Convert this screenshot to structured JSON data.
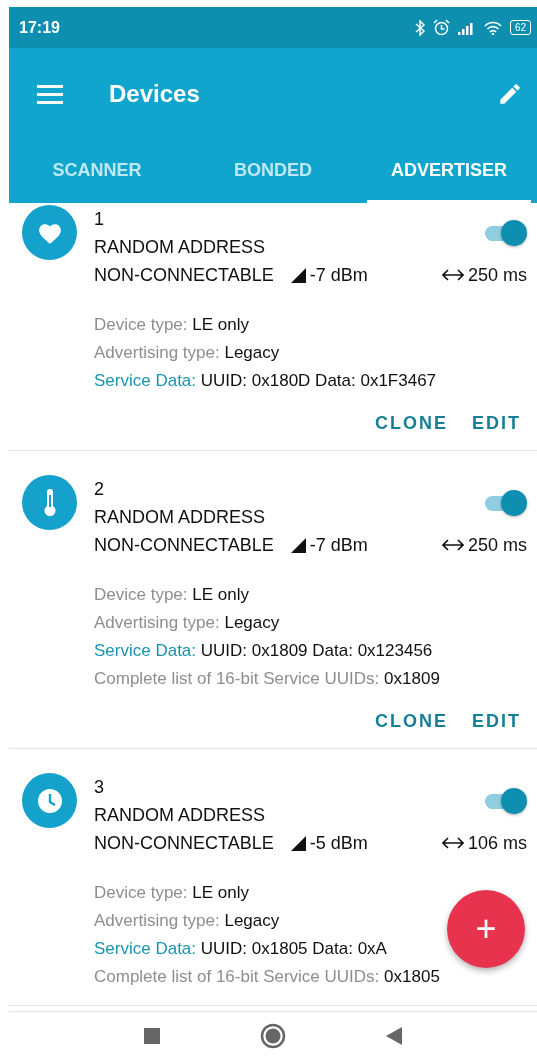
{
  "status_bar": {
    "time": "17:19",
    "battery": "62"
  },
  "toolbar": {
    "title": "Devices"
  },
  "tabs": [
    {
      "label": "SCANNER",
      "selected": false
    },
    {
      "label": "BONDED",
      "selected": false
    },
    {
      "label": "ADVERTISER",
      "selected": true
    }
  ],
  "cards": [
    {
      "kind": "heart",
      "number": "1",
      "address": "RANDOM ADDRESS",
      "mode": "NON-CONNECTABLE",
      "tx_power": "-7 dBm",
      "interval": "250 ms",
      "on": true,
      "details": [
        {
          "kind": "plain",
          "label": "Device type:",
          "value": "LE only"
        },
        {
          "kind": "plain",
          "label": "Advertising type:",
          "value": "Legacy"
        },
        {
          "kind": "service",
          "label": "Service Data:",
          "value": "UUID: 0x180D Data: 0x1F3467"
        }
      ],
      "actions": [
        "CLONE",
        "EDIT"
      ]
    },
    {
      "kind": "thermometer",
      "number": "2",
      "address": "RANDOM ADDRESS",
      "mode": "NON-CONNECTABLE",
      "tx_power": "-7 dBm",
      "interval": "250 ms",
      "on": true,
      "details": [
        {
          "kind": "plain",
          "label": "Device type:",
          "value": "LE only"
        },
        {
          "kind": "plain",
          "label": "Advertising type:",
          "value": "Legacy"
        },
        {
          "kind": "service",
          "label": "Service Data:",
          "value": "UUID: 0x1809 Data: 0x123456"
        },
        {
          "kind": "plain",
          "label": "Complete list of 16-bit Service UUIDs:",
          "value": "0x1809"
        }
      ],
      "actions": [
        "CLONE",
        "EDIT"
      ]
    },
    {
      "kind": "clock",
      "number": "3",
      "address": "RANDOM ADDRESS",
      "mode": "NON-CONNECTABLE",
      "tx_power": "-5 dBm",
      "interval": "106 ms",
      "on": true,
      "details": [
        {
          "kind": "plain",
          "label": "Device type:",
          "value": "LE only"
        },
        {
          "kind": "plain",
          "label": "Advertising type:",
          "value": "Legacy"
        },
        {
          "kind": "service",
          "label": "Service Data:",
          "value": "UUID: 0x1805 Data: 0xA"
        },
        {
          "kind": "plain",
          "label": "Complete list of 16-bit Service UUIDs:",
          "value": "0x1805"
        }
      ]
    }
  ],
  "fab": {
    "label": "+"
  }
}
